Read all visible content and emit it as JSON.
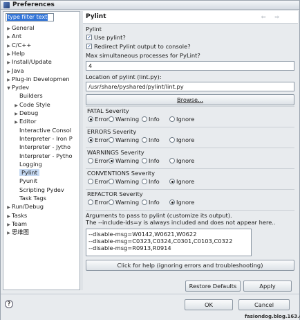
{
  "window": {
    "title": "Preferences"
  },
  "sidebar": {
    "filter_text": "type filter text",
    "items": [
      {
        "label": "General",
        "arrow": "▶"
      },
      {
        "label": "Ant",
        "arrow": "▶"
      },
      {
        "label": "C/C++",
        "arrow": "▶"
      },
      {
        "label": "Help",
        "arrow": "▶"
      },
      {
        "label": "Install/Update",
        "arrow": "▶"
      },
      {
        "label": "Java",
        "arrow": "▶"
      },
      {
        "label": "Plug-in Developmen",
        "arrow": "▶"
      },
      {
        "label": "Pydev",
        "arrow": "▼"
      },
      {
        "label": "Builders",
        "arrow": ""
      },
      {
        "label": "Code Style",
        "arrow": "▶"
      },
      {
        "label": "Debug",
        "arrow": "▶"
      },
      {
        "label": "Editor",
        "arrow": "▶"
      },
      {
        "label": "Interactive Consol",
        "arrow": ""
      },
      {
        "label": "Interpreter - Iron P",
        "arrow": ""
      },
      {
        "label": "Interpreter - Jytho",
        "arrow": ""
      },
      {
        "label": "Interpreter - Pytho",
        "arrow": ""
      },
      {
        "label": "Logging",
        "arrow": ""
      },
      {
        "label": "Pylint",
        "arrow": ""
      },
      {
        "label": "Pyunit",
        "arrow": ""
      },
      {
        "label": "Scripting Pydev",
        "arrow": ""
      },
      {
        "label": "Task Tags",
        "arrow": ""
      },
      {
        "label": "Run/Debug",
        "arrow": "▶"
      },
      {
        "label": "Tasks",
        "arrow": "▶"
      },
      {
        "label": "Team",
        "arrow": "▶"
      },
      {
        "label": "思维图",
        "arrow": "▶"
      }
    ]
  },
  "page": {
    "title": "Pylint",
    "nav_back": "⇦",
    "nav_forward": "⇨",
    "section_label": "Pylint",
    "use_pylint": {
      "label": "Use pylint?",
      "checked": true
    },
    "redirect": {
      "label": "Redirect Pylint output to console?",
      "checked": true
    },
    "max_processes": {
      "label": "Max simultaneous processes for PyLint?",
      "value": "4"
    },
    "location": {
      "label": "Location of pylint (lint.py):",
      "value": "/usr/share/pyshared/pylint/lint.py"
    },
    "browse_label": "Browse...",
    "severity_options": [
      "Error",
      "Warning",
      "Info",
      "Ignore"
    ],
    "groups": [
      {
        "label": "FATAL Severity",
        "selected": "Error"
      },
      {
        "label": "ERRORS Severity",
        "selected": "Error"
      },
      {
        "label": "WARNINGS Severity",
        "selected": "Warning"
      },
      {
        "label": "CONVENTIONS Severity",
        "selected": "Ignore"
      },
      {
        "label": "REFACTOR Severity",
        "selected": "Ignore"
      }
    ],
    "arguments_label": "Arguments to pass to pylint (customize its output).",
    "arguments_note": "The  --include-ids=y is always included and does not appear here..",
    "arguments_lines": [
      "--disable-msg=W0142,W0621,W0622",
      "--disable-msg=C0323,C0324,C0301,C0103,C0322",
      "--disable-msg=R0913,R0914"
    ],
    "help_button": "Click for help (ignoring errors and troubleshooting)",
    "restore_defaults": "Restore Defaults",
    "apply": "Apply"
  },
  "footer": {
    "help_icon": "?",
    "ok": "OK",
    "cancel": "Cancel",
    "watermark": "fasiondog.blog.163.com"
  }
}
